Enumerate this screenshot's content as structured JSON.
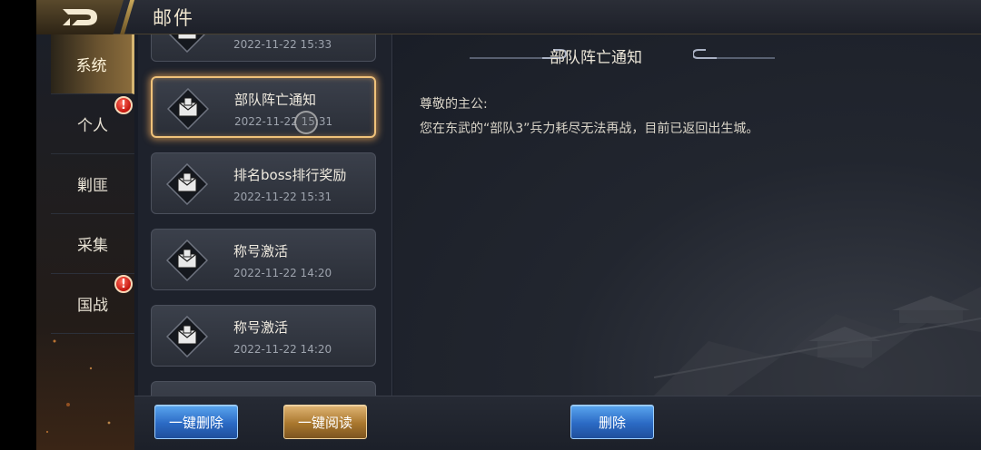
{
  "header": {
    "title": "邮件"
  },
  "sidebar": {
    "tabs": [
      {
        "label": "系统",
        "active": true,
        "badge": false
      },
      {
        "label": "个人",
        "active": false,
        "badge": true
      },
      {
        "label": "剿匪",
        "active": false,
        "badge": false
      },
      {
        "label": "采集",
        "active": false,
        "badge": false
      },
      {
        "label": "国战",
        "active": false,
        "badge": true
      }
    ],
    "badge_glyph": "!"
  },
  "mail_list": {
    "items": [
      {
        "title": "",
        "time": "2022-11-22   15:33",
        "selected": false
      },
      {
        "title": "部队阵亡通知",
        "time": "2022-11-22   15:31",
        "selected": true
      },
      {
        "title": "排名boss排行奖励",
        "time": "2022-11-22   15:31",
        "selected": false
      },
      {
        "title": "称号激活",
        "time": "2022-11-22   14:20",
        "selected": false
      },
      {
        "title": "称号激活",
        "time": "2022-11-22   14:20",
        "selected": false
      }
    ]
  },
  "detail": {
    "title": "部队阵亡通知",
    "greeting": "尊敬的主公:",
    "body": "您在东武的“部队3”兵力耗尽无法再战，目前已返回出生城。"
  },
  "actions": {
    "delete_all": "一键删除",
    "read_all": "一键阅读",
    "delete": "删除"
  },
  "colors": {
    "accent_gold": "#d5b571",
    "button_blue": "#2b6ac4",
    "button_gold": "#a9772e",
    "badge_red": "#c3150d"
  }
}
